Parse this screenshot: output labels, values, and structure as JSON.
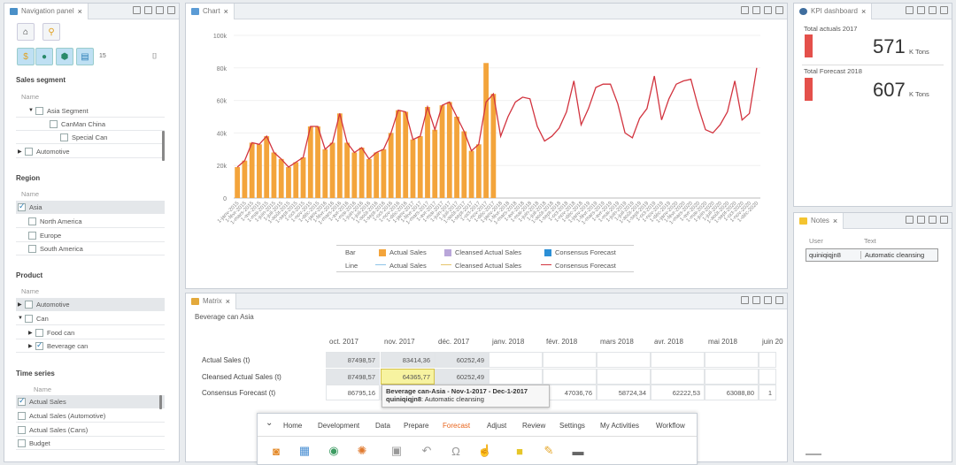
{
  "nav_panel": {
    "tab_label": "Navigation panel",
    "segment": {
      "title": "Sales segment",
      "header": "Name",
      "items": [
        {
          "label": "Asia Segment",
          "checked": false
        },
        {
          "label": "CanMan China",
          "checked": false
        },
        {
          "label": "Special Can",
          "checked": false
        },
        {
          "label": "Automotive",
          "checked": false
        }
      ]
    },
    "region": {
      "title": "Region",
      "header": "Name",
      "items": [
        {
          "label": "Asia",
          "checked": true
        },
        {
          "label": "North America",
          "checked": false
        },
        {
          "label": "Europe",
          "checked": false
        },
        {
          "label": "South America",
          "checked": false
        }
      ]
    },
    "product": {
      "title": "Product",
      "header": "Name",
      "items": [
        {
          "label": "Automotive",
          "checked": false
        },
        {
          "label": "Can",
          "checked": false
        },
        {
          "label": "Food can",
          "checked": false
        },
        {
          "label": "Beverage can",
          "checked": true
        }
      ]
    },
    "timeseries": {
      "title": "Time series",
      "header": "Name",
      "items": [
        {
          "label": "Actual Sales",
          "checked": true
        },
        {
          "label": "Actual Sales (Automotive)",
          "checked": false
        },
        {
          "label": "Actual Sales (Cans)",
          "checked": false
        },
        {
          "label": "Budget",
          "checked": false
        }
      ]
    },
    "small_badge": "15"
  },
  "chart_panel": {
    "tab_label": "Chart",
    "legend": {
      "bar_label": "Bar",
      "line_label": "Line",
      "bar_items": [
        "Actual Sales",
        "Cleansed Actual Sales",
        "Consensus Forecast"
      ],
      "line_items": [
        "Actual Sales",
        "Cleansed Actual Sales",
        "Consensus Forecast"
      ],
      "bar_colors": [
        "#f3a43b",
        "#b9a6d9",
        "#2c8fd6"
      ],
      "line_colors": [
        "#8fc4e8",
        "#e5c46b",
        "#d2343f"
      ]
    }
  },
  "chart_data": {
    "type": "bar",
    "title": "",
    "xlabel": "",
    "ylabel": "",
    "ylim": [
      0,
      100000
    ],
    "y_ticks": [
      "0",
      "20k",
      "40k",
      "60k",
      "80k",
      "100k"
    ],
    "y_tick_values": [
      0,
      20000,
      40000,
      60000,
      80000,
      100000
    ],
    "categories": [
      "1-janv-2015",
      "1-févr-2015",
      "1-mars-2015",
      "1-avr-2015",
      "1-mai-2015",
      "1-juin-2015",
      "1-juil-2015",
      "1-août-2015",
      "1-sept-2015",
      "1-oct-2015",
      "1-nov-2015",
      "1-déc-2015",
      "1-janv-2016",
      "1-févr-2016",
      "1-mars-2016",
      "1-avr-2016",
      "1-mai-2016",
      "1-juin-2016",
      "1-juil-2016",
      "1-août-2016",
      "1-sept-2016",
      "1-oct-2016",
      "1-nov-2016",
      "1-déc-2016",
      "1-janv-2017",
      "1-févr-2017",
      "1-mars-2017",
      "1-avr-2017",
      "1-mai-2017",
      "1-juin-2017",
      "1-juil-2017",
      "1-août-2017",
      "1-sept-2017",
      "1-oct-2017",
      "1-nov-2017",
      "1-déc-2017",
      "1-janv-2018",
      "1-févr-2018",
      "1-mars-2018",
      "1-avr-2018",
      "1-mai-2018",
      "1-juin-2018",
      "1-juil-2018",
      "1-août-2018",
      "1-sept-2018",
      "1-oct-2018",
      "1-nov-2018",
      "1-déc-2018",
      "1-janv-2019",
      "1-févr-2019",
      "1-mars-2019",
      "1-avr-2019",
      "1-mai-2019",
      "1-juin-2019",
      "1-juil-2019",
      "1-août-2019",
      "1-sept-2019",
      "1-oct-2019",
      "1-nov-2019",
      "1-déc-2019",
      "1-janv-2020",
      "1-févr-2020",
      "1-mars-2020",
      "1-avr-2020",
      "1-mai-2020",
      "1-juin-2020",
      "1-juil-2020",
      "1-août-2020",
      "1-sept-2020",
      "1-oct-2020",
      "1-nov-2020",
      "1-déc-2020"
    ],
    "x_tick_labels": [
      "1-janv-2015",
      "1-févr-2015",
      "1-mars-2015",
      "1-avr-2015",
      "1-mai-2015",
      "1-juin-2015",
      "1-juil-2015",
      "1-août-2015",
      "1-sept-2015",
      "1-oct-2015",
      "1-nov-2015",
      "1-déc-2015",
      "1-janv-2016",
      "1-févr-2016",
      "1-mars-2016",
      "1-avr-2016",
      "1-mai-2016",
      "1-juin-2016",
      "1-juil-2016",
      "1-août-2016",
      "1-sept-2016",
      "1-oct-2016",
      "1-nov-2016",
      "1-déc-2016",
      "1-janv-2017",
      "1-févr-2017",
      "1-mars-2017",
      "1-avr-2017",
      "1-mai-2017",
      "1-juin-2017",
      "1-juil-2017",
      "1-août-2017",
      "1-sept-2017",
      "1-oct-2017",
      "1-nov-2017",
      "1-déc-2017",
      "1-janv-2018",
      "1-févr-2018",
      "1-mars-2018",
      "1-avr-2018",
      "1-mai-2018",
      "1-juin-2018",
      "1-juil-2018",
      "1-août-2018",
      "1-sept-2018",
      "1-oct-2018",
      "1-nov-2018",
      "1-déc-2018",
      "1-janv-2019",
      "1-févr-2019",
      "1-mars-2019",
      "1-avr-2019",
      "1-mai-2019",
      "1-juin-2019",
      "1-juil-2019",
      "1-août-2019",
      "1-sept-2019",
      "1-oct-2019",
      "1-nov-2019",
      "1-déc-2019",
      "1-janv-2020",
      "1-févr-2020",
      "1-mars-2020",
      "1-avr-2020",
      "1-mai-2020",
      "1-juin-2020",
      "1-juil-2020",
      "1-août-2020",
      "1-sept-2020",
      "1-oct-2020",
      "1-nov-2020",
      "1-déc-2020"
    ],
    "series": [
      {
        "name": "Actual Sales",
        "kind": "bar",
        "values": [
          19000,
          23000,
          34000,
          33000,
          38000,
          28000,
          24000,
          19000,
          22000,
          25000,
          44000,
          44000,
          30000,
          34000,
          52000,
          34000,
          28000,
          31000,
          24000,
          28000,
          30000,
          40000,
          54000,
          53000,
          36000,
          38000,
          56000,
          42000,
          57000,
          59000,
          50000,
          41000,
          29000,
          33000,
          83000,
          64000
        ]
      },
      {
        "name": "Consensus Forecast",
        "kind": "line",
        "values": [
          19000,
          23000,
          34000,
          33000,
          38000,
          28000,
          24000,
          19000,
          22000,
          25000,
          44000,
          44000,
          30000,
          34000,
          52000,
          34000,
          28000,
          31000,
          24000,
          28000,
          30000,
          40000,
          54000,
          53000,
          36000,
          38000,
          56000,
          42000,
          57000,
          59000,
          50000,
          41000,
          29000,
          33000,
          59000,
          64000,
          38000,
          50000,
          59000,
          62000,
          61000,
          44000,
          35000,
          38000,
          43000,
          53000,
          72000,
          45000,
          55000,
          68000,
          70000,
          70000,
          58000,
          40000,
          37000,
          49000,
          55000,
          75000,
          48000,
          61000,
          70000,
          72000,
          73000,
          56000,
          42000,
          40000,
          45000,
          53000,
          72000,
          48000,
          52000,
          80000
        ]
      }
    ]
  },
  "matrix_panel": {
    "tab_label": "Matrix",
    "subtitle": "Beverage can Asia",
    "columns": [
      "oct. 2017",
      "nov. 2017",
      "déc. 2017",
      "janv. 2018",
      "févr. 2018",
      "mars 2018",
      "avr. 2018",
      "mai 2018",
      "juin 20"
    ],
    "rows": [
      {
        "label": "Actual Sales (t)",
        "cells": [
          "87498,57",
          "83414,36",
          "60252,49",
          "",
          "",
          "",
          "",
          "",
          ""
        ]
      },
      {
        "label": "Cleansed Actual Sales (t)",
        "cells": [
          "87498,57",
          "64365,77",
          "60252,49",
          "",
          "",
          "",
          "",
          "",
          ""
        ]
      },
      {
        "label": "Consensus Forecast (t)",
        "cells": [
          "86795,16",
          "",
          "",
          "",
          "47036,76",
          "58724,34",
          "62222,53",
          "63088,80",
          "1"
        ]
      }
    ],
    "tooltip_title": "Beverage can-Asia - Nov-1-2017 - Dec-1-2017",
    "tooltip_user": "quiniqiqjn8",
    "tooltip_text": "Automatic cleansing"
  },
  "kpi_panel": {
    "tab_label": "KPI dashboard",
    "items": [
      {
        "label": "Total actuals 2017",
        "value": "571",
        "unit": "K Tons"
      },
      {
        "label": "Total Forecast 2018",
        "value": "607",
        "unit": "K Tons"
      }
    ],
    "bar_color": "#e4504b"
  },
  "notes_panel": {
    "tab_label": "Notes",
    "headers": [
      "User",
      "Text"
    ],
    "rows": [
      {
        "user": "quiniqiqjn8",
        "text": "Automatic cleansing"
      }
    ]
  },
  "menu": {
    "items": [
      "Home",
      "Development",
      "Data",
      "Prepare",
      "Forecast",
      "Adjust",
      "Review",
      "Settings",
      "My Activities",
      "Workflow"
    ],
    "active": "Forecast",
    "chevron": "⌄",
    "icons": [
      "database-icon",
      "grid-icon",
      "globe-icon",
      "cogs-icon",
      "save-icon",
      "undo-icon",
      "headset-icon",
      "hand-icon",
      "note-add-icon",
      "pencil-icon",
      "trash-icon"
    ]
  }
}
